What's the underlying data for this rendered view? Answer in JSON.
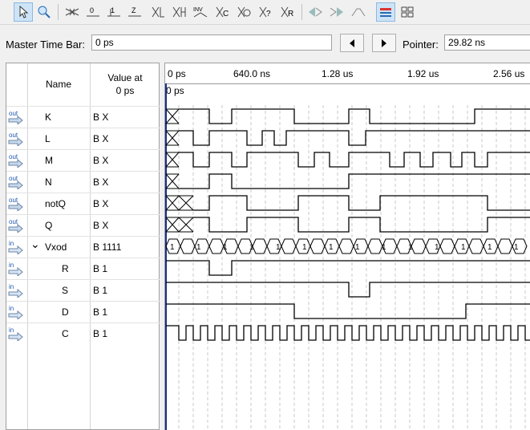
{
  "toolbar": {
    "icons": [
      "select-arrow-icon",
      "zoom-icon",
      "force-unknown-icon",
      "force-low-icon",
      "force-high-icon",
      "force-zero-icon",
      "invert-low-icon",
      "invert-high-icon",
      "invert-icon",
      "count-value-icon",
      "clock-icon",
      "random-icon",
      "arbitrary-value-icon",
      "snap-left-icon",
      "snap-right-icon",
      "edit-waveform-icon",
      "sort-icon",
      "grid-icon"
    ]
  },
  "master_time_bar": {
    "label": "Master Time Bar:",
    "value": "0 ps"
  },
  "pointer": {
    "label": "Pointer:",
    "value": "29.82 ns"
  },
  "columns": {
    "name": "Name",
    "value_line1": "Value at",
    "value_line2": "0 ps"
  },
  "ruler": {
    "ticks": [
      "0 ps",
      "640.0 ns",
      "1.28 us",
      "1.92 us",
      "2.56 us"
    ],
    "cursor_label": "0 ps"
  },
  "signals": [
    {
      "type": "out",
      "name": "K",
      "value": "B X"
    },
    {
      "type": "out",
      "name": "L",
      "value": "B X"
    },
    {
      "type": "out",
      "name": "M",
      "value": "B X"
    },
    {
      "type": "out",
      "name": "N",
      "value": "B X"
    },
    {
      "type": "out",
      "name": "notQ",
      "value": "B X"
    },
    {
      "type": "out",
      "name": "Q",
      "value": "B X"
    },
    {
      "type": "in",
      "name": "Vxod",
      "value": "B 1111",
      "expanded": true
    },
    {
      "type": "in",
      "name": "R",
      "value": "B 1"
    },
    {
      "type": "in",
      "name": "S",
      "value": "B 1"
    },
    {
      "type": "in",
      "name": "D",
      "value": "B 1"
    },
    {
      "type": "in",
      "name": "C",
      "value": "B 1"
    }
  ],
  "bus_labels": [
    "1",
    "1",
    "1",
    "1",
    "1",
    "1",
    "1",
    "1",
    "1",
    "1",
    "1",
    "1",
    "1",
    "1"
  ]
}
